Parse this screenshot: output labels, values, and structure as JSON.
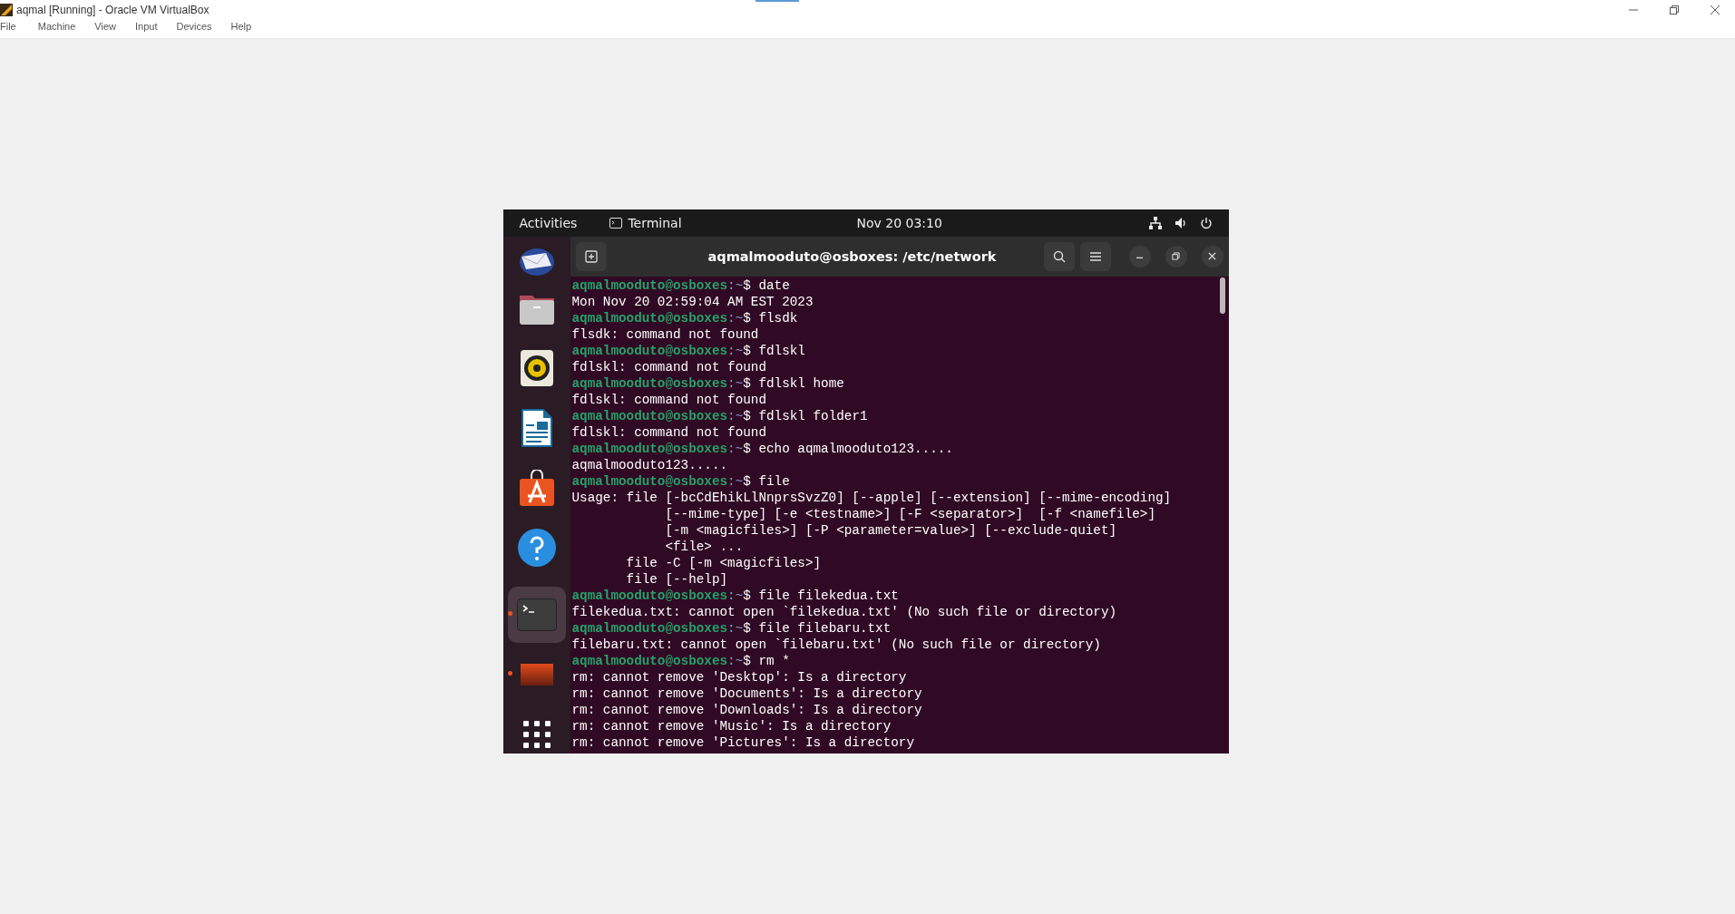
{
  "window": {
    "title": "aqmal [Running] - Oracle VM VirtualBox"
  },
  "menu": [
    "File",
    "Machine",
    "View",
    "Input",
    "Devices",
    "Help"
  ],
  "guest": {
    "top_bar": {
      "activities": "Activities",
      "app": "Terminal",
      "clock": "Nov 20  03:10"
    },
    "dock": [
      {
        "kind": "mail",
        "running": false,
        "selected": false
      },
      {
        "kind": "files",
        "running": false,
        "selected": false
      },
      {
        "kind": "music",
        "running": false,
        "selected": false
      },
      {
        "kind": "writer",
        "running": false,
        "selected": false
      },
      {
        "kind": "software",
        "running": false,
        "selected": false
      },
      {
        "kind": "help",
        "running": false,
        "selected": false
      },
      {
        "kind": "separator"
      },
      {
        "kind": "terminal",
        "running": true,
        "selected": true
      },
      {
        "kind": "image",
        "running": true,
        "selected": false
      },
      {
        "kind": "apps",
        "running": false,
        "selected": false
      }
    ],
    "terminal": {
      "title": "aqmalmooduto@osboxes: /etc/network",
      "lines": [
        {
          "kind": "prompt",
          "user": "aqmalmooduto@osboxes",
          "path": ":~",
          "command": "$ date"
        },
        {
          "kind": "output",
          "text": "Mon Nov 20 02:59:04 AM EST 2023"
        },
        {
          "kind": "prompt",
          "user": "aqmalmooduto@osboxes",
          "path": ":~",
          "command": "$ flsdk"
        },
        {
          "kind": "output",
          "text": "flsdk: command not found"
        },
        {
          "kind": "prompt",
          "user": "aqmalmooduto@osboxes",
          "path": ":~",
          "command": "$ fdlskl"
        },
        {
          "kind": "output",
          "text": "fdlskl: command not found"
        },
        {
          "kind": "prompt",
          "user": "aqmalmooduto@osboxes",
          "path": ":~",
          "command": "$ fdlskl home"
        },
        {
          "kind": "output",
          "text": "fdlskl: command not found"
        },
        {
          "kind": "prompt",
          "user": "aqmalmooduto@osboxes",
          "path": ":~",
          "command": "$ fdlskl folder1"
        },
        {
          "kind": "output",
          "text": "fdlskl: command not found"
        },
        {
          "kind": "prompt",
          "user": "aqmalmooduto@osboxes",
          "path": ":~",
          "command": "$ echo aqmalmooduto123....."
        },
        {
          "kind": "output",
          "text": "aqmalmooduto123....."
        },
        {
          "kind": "prompt",
          "user": "aqmalmooduto@osboxes",
          "path": ":~",
          "command": "$ file"
        },
        {
          "kind": "output",
          "text": "Usage: file [-bcCdEhikLlNnprsSvzZ0] [--apple] [--extension] [--mime-encoding]"
        },
        {
          "kind": "output",
          "text": "            [--mime-type] [-e <testname>] [-F <separator>]  [-f <namefile>]"
        },
        {
          "kind": "output",
          "text": "            [-m <magicfiles>] [-P <parameter=value>] [--exclude-quiet]"
        },
        {
          "kind": "output",
          "text": "            <file> ..."
        },
        {
          "kind": "output",
          "text": "       file -C [-m <magicfiles>]"
        },
        {
          "kind": "output",
          "text": "       file [--help]"
        },
        {
          "kind": "prompt",
          "user": "aqmalmooduto@osboxes",
          "path": ":~",
          "command": "$ file filekedua.txt"
        },
        {
          "kind": "output",
          "text": "filekedua.txt: cannot open `filekedua.txt' (No such file or directory)"
        },
        {
          "kind": "prompt",
          "user": "aqmalmooduto@osboxes",
          "path": ":~",
          "command": "$ file filebaru.txt"
        },
        {
          "kind": "output",
          "text": "filebaru.txt: cannot open `filebaru.txt' (No such file or directory)"
        },
        {
          "kind": "prompt",
          "user": "aqmalmooduto@osboxes",
          "path": ":~",
          "command": "$ rm *"
        },
        {
          "kind": "output",
          "text": "rm: cannot remove 'Desktop': Is a directory"
        },
        {
          "kind": "output",
          "text": "rm: cannot remove 'Documents': Is a directory"
        },
        {
          "kind": "output",
          "text": "rm: cannot remove 'Downloads': Is a directory"
        },
        {
          "kind": "output",
          "text": "rm: cannot remove 'Music': Is a directory"
        },
        {
          "kind": "output",
          "text": "rm: cannot remove 'Pictures': Is a directory"
        }
      ]
    }
  }
}
